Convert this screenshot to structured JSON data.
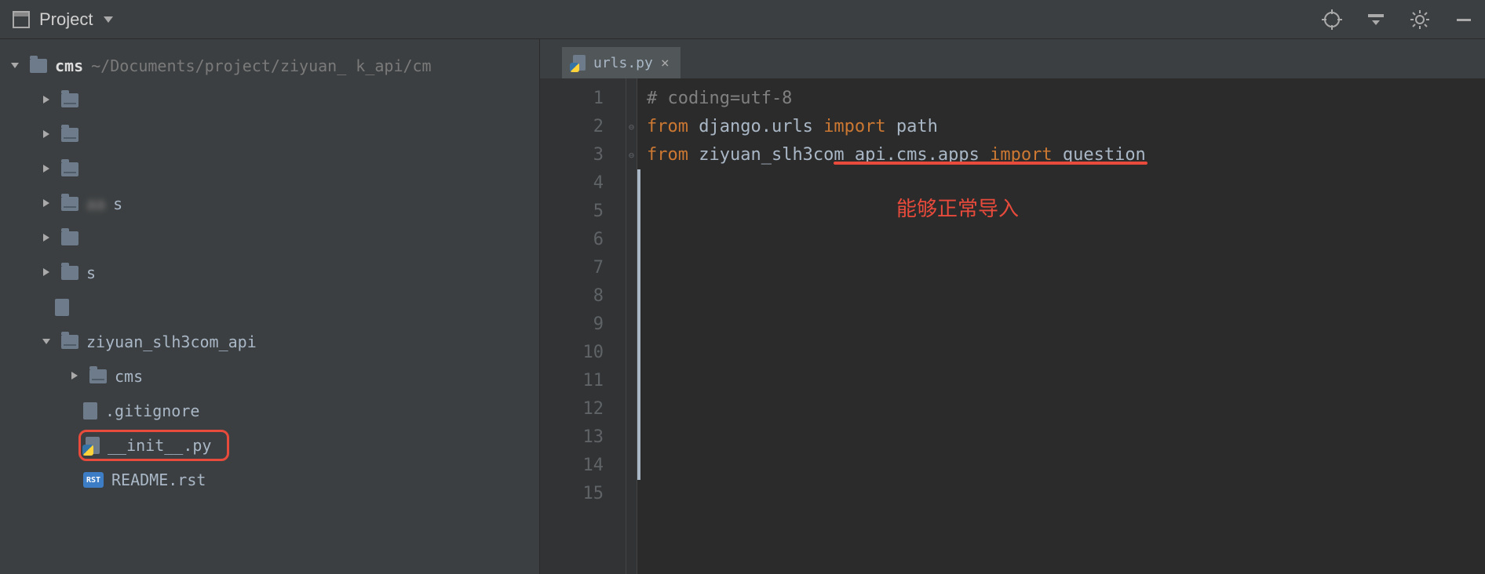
{
  "toolbar": {
    "project_label": "Project"
  },
  "tab": {
    "filename": "urls.py"
  },
  "tree": {
    "root_name": "cms",
    "root_path": "~/Documents/project/ziyuan_    k_api/cm",
    "nodes": [
      {
        "label": ""
      },
      {
        "label": ""
      },
      {
        "label": ""
      },
      {
        "label": "s"
      },
      {
        "label": ""
      },
      {
        "label": "s"
      }
    ],
    "blurred_file": " ",
    "pkg_name": "ziyuan_slh3com_api",
    "sub_pkg": "cms",
    "gitignore": ".gitignore",
    "init_py": "__init__.py",
    "readme": "README.rst"
  },
  "code": {
    "line1_comment": "# coding=utf-8",
    "line2": {
      "from": "from",
      "mod": "django.urls",
      "import": "import",
      "name": "path"
    },
    "line3": {
      "from": "from",
      "mod": "ziyuan_slh3com_api.cms.apps",
      "import": "import",
      "name": "question"
    }
  },
  "gutter_lines": [
    "1",
    "2",
    "3",
    "4",
    "5",
    "6",
    "7",
    "8",
    "9",
    "10",
    "11",
    "12",
    "13",
    "14",
    "15"
  ],
  "annotation_text": "能够正常导入"
}
